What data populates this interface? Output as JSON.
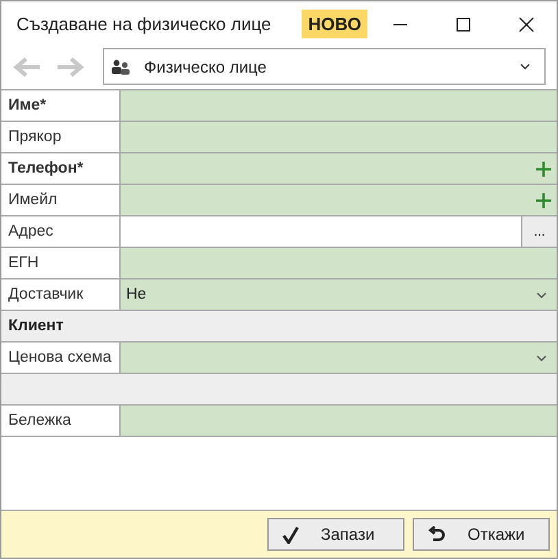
{
  "window": {
    "title": "Създаване на физическо лице",
    "badge": "НОВО"
  },
  "toolbar": {
    "back_disabled": true,
    "forward_disabled": true,
    "type_selector": {
      "value": "Физическо лице"
    }
  },
  "rows": [
    {
      "kind": "field",
      "label": "Име*",
      "required": true,
      "has_add": false
    },
    {
      "kind": "field",
      "label": "Прякор",
      "required": false,
      "has_add": false
    },
    {
      "kind": "field",
      "label": "Телефон*",
      "required": true,
      "has_add": true
    },
    {
      "kind": "field",
      "label": "Имейл",
      "required": false,
      "has_add": true
    },
    {
      "kind": "browse",
      "label": "Адрес",
      "required": false,
      "button": "..."
    },
    {
      "kind": "field",
      "label": "ЕГН",
      "required": false,
      "has_add": false
    },
    {
      "kind": "dropdown",
      "label": "Доставчик",
      "required": false,
      "value": "Не"
    },
    {
      "kind": "section",
      "label": "Клиент"
    },
    {
      "kind": "dropdown",
      "label": "Ценова схема",
      "required": false
    },
    {
      "kind": "spacer"
    },
    {
      "kind": "field",
      "label": "Бележка",
      "required": false,
      "has_add": false
    }
  ],
  "buttons": [
    {
      "kind": "save",
      "label": "Запази"
    },
    {
      "kind": "cancel",
      "label": "Откажи"
    }
  ]
}
